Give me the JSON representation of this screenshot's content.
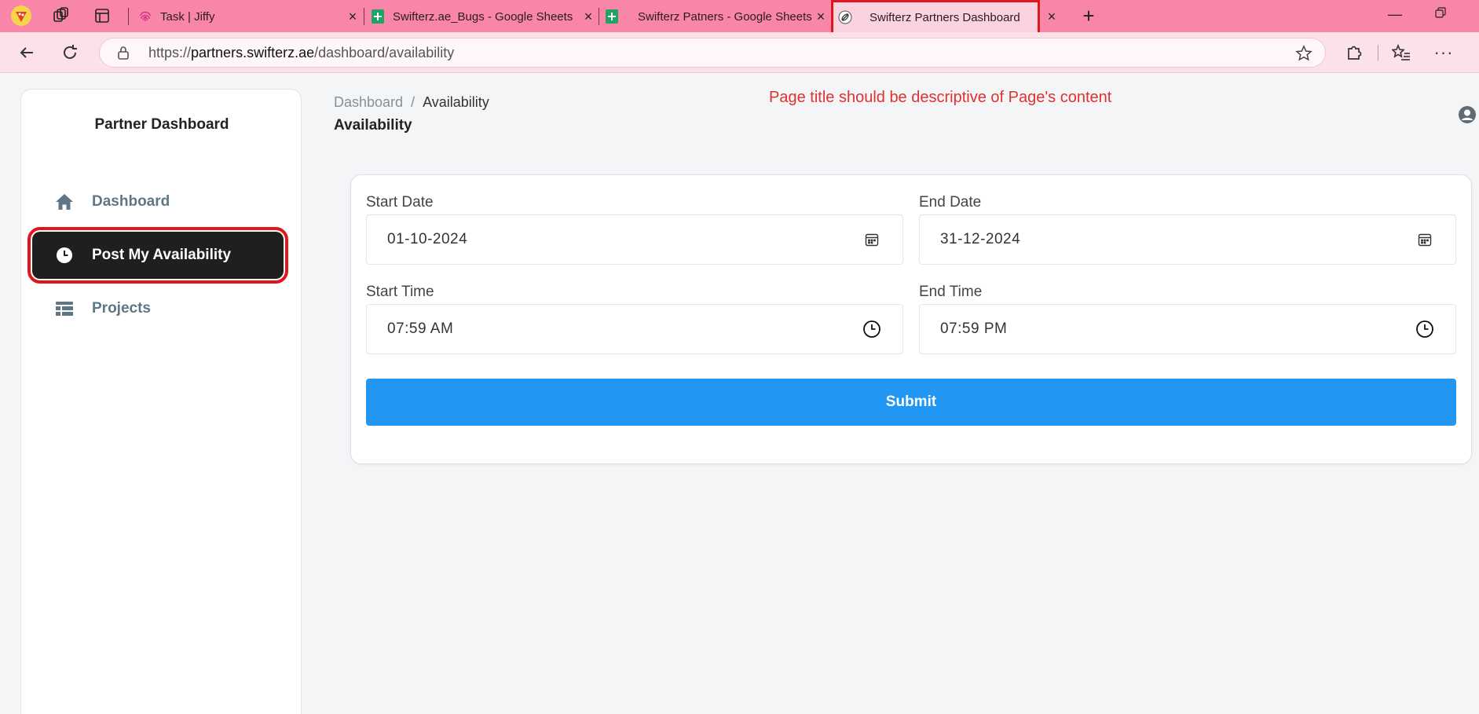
{
  "browser": {
    "tabs": [
      {
        "title": "Task | Jiffy"
      },
      {
        "title": "Swifterz.ae_Bugs - Google Sheets"
      },
      {
        "title": "Swifterz Patners - Google Sheets"
      },
      {
        "title": "Swifterz Partners Dashboard"
      }
    ],
    "new_tab_label": "+",
    "close_label": "×",
    "url_prefix": "https://",
    "url_domain": "partners.swifterz.ae",
    "url_path": "/dashboard/availability"
  },
  "sidebar": {
    "title": "Partner Dashboard",
    "items": [
      {
        "label": "Dashboard",
        "icon": "home-icon"
      },
      {
        "label": "Post My Availability",
        "icon": "clock-icon"
      },
      {
        "label": "Projects",
        "icon": "table-icon"
      }
    ]
  },
  "header": {
    "breadcrumb_root": "Dashboard",
    "breadcrumb_sep": "/",
    "breadcrumb_current": "Availability",
    "page_title": "Availability",
    "annotation": "Page title should be descriptive of Page's content"
  },
  "form": {
    "start_date": {
      "label": "Start Date",
      "value": "01-10-2024"
    },
    "end_date": {
      "label": "End Date",
      "value": "31-12-2024"
    },
    "start_time": {
      "label": "Start Time",
      "value": "07:59 AM"
    },
    "end_time": {
      "label": "End Time",
      "value": "07:59 PM"
    },
    "submit_label": "Submit"
  },
  "colors": {
    "tabbar": "#f986a8",
    "accent": "#2196f3",
    "highlight": "#e2141c",
    "sidebar_active": "#1f1f1f"
  }
}
